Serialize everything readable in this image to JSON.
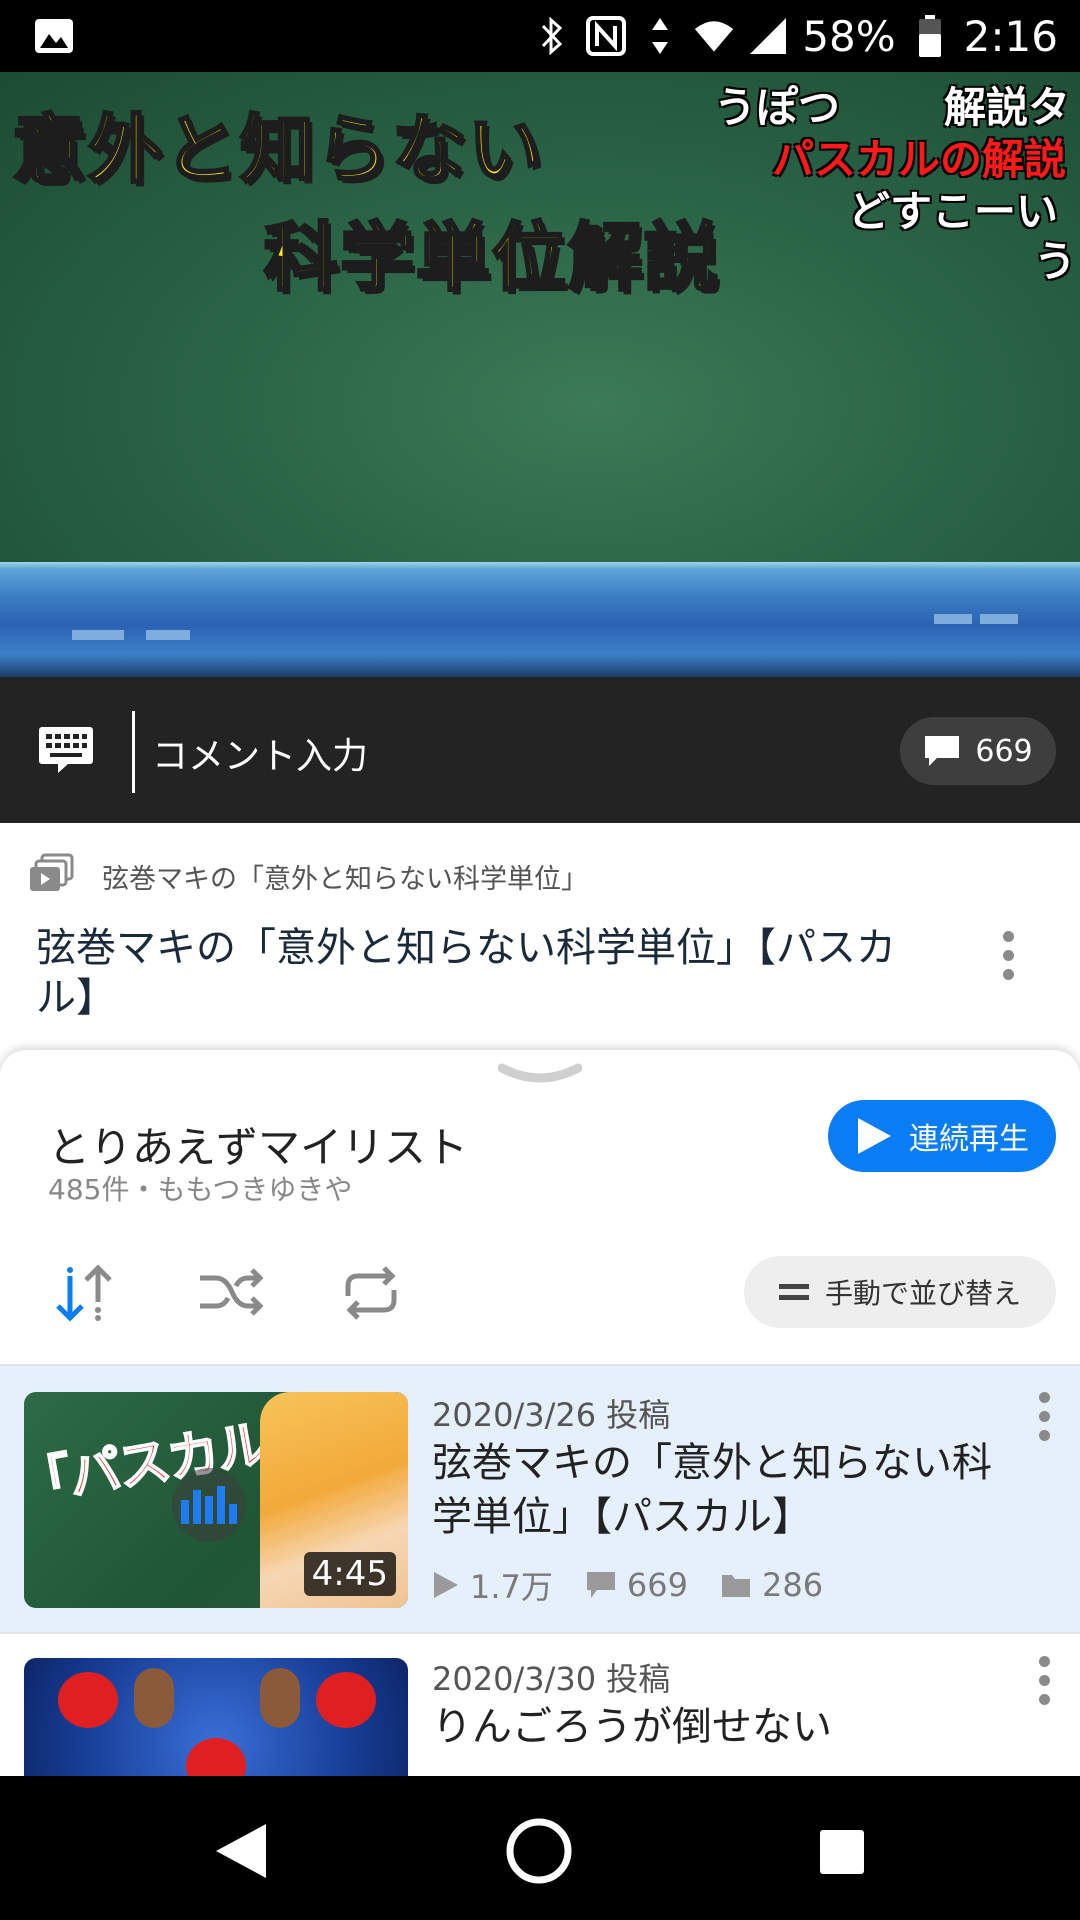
{
  "status_bar": {
    "battery_percent": "58%",
    "time": "2:16",
    "icons": [
      "image-icon",
      "bluetooth-icon",
      "nfc-icon",
      "data-arrows-icon",
      "wifi-icon",
      "signal-icon",
      "battery-icon"
    ]
  },
  "player": {
    "title_line1": "意外と知らない",
    "title_line2": "科学単位解説",
    "flowing_comments": [
      {
        "text": "うぽつ",
        "color": "#ffffff"
      },
      {
        "text": "解説タ",
        "color": "#ffffff"
      },
      {
        "text": "パスカルの解説",
        "color": "#ff1a1a"
      },
      {
        "text": "どすこーい",
        "color": "#ffffff"
      },
      {
        "text": "う",
        "color": "#ffffff"
      }
    ]
  },
  "comment_bar": {
    "placeholder": "コメント入力",
    "count": "669"
  },
  "video_info": {
    "series": "弦巻マキの「意外と知らない科学単位」",
    "title": "弦巻マキの「意外と知らない科学単位」【パスカル】"
  },
  "mylist": {
    "title": "とりあえずマイリスト",
    "meta": "485件・ももつきゆきや",
    "play_all_label": "連続再生",
    "sort_label": "手動で並び替え",
    "accent_color": "#0a7cf4"
  },
  "items": [
    {
      "date": "2020/3/26 投稿",
      "title": "弦巻マキの「意外と知らない科学単位」【パスカル】",
      "duration": "4:45",
      "thumb_text": "「パスカル」を解説！",
      "views": "1.7万",
      "comments": "669",
      "mylists": "286",
      "playing": true
    },
    {
      "date": "2020/3/30 投稿",
      "title": "りんごろうが倒せない",
      "playing": false
    }
  ]
}
